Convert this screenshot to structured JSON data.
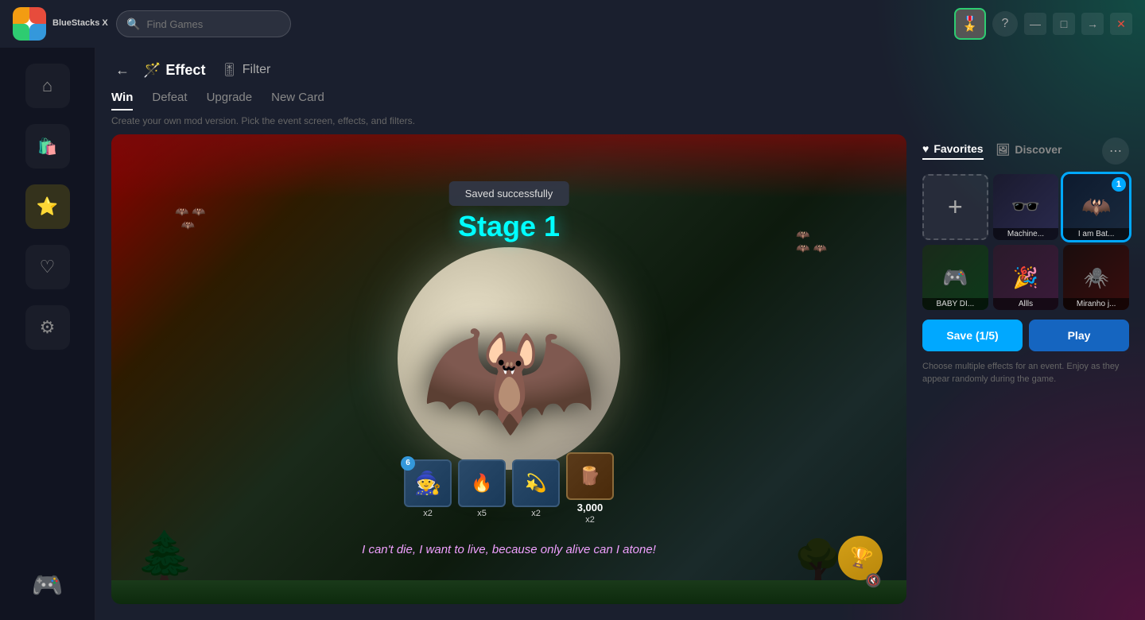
{
  "app": {
    "name": "BlueStacks X",
    "logo_icon": "🎮"
  },
  "titlebar": {
    "search_placeholder": "Find Games",
    "avatar_emoji": "🎖️",
    "help_btn": "?",
    "minimize_btn": "—",
    "restore_btn": "□",
    "forward_btn": "→",
    "close_btn": "✕"
  },
  "sidebar": {
    "items": [
      {
        "id": "home",
        "icon": "⌂",
        "label": "Home"
      },
      {
        "id": "store",
        "icon": "🛍️",
        "label": "Store"
      },
      {
        "id": "effects",
        "icon": "⭐",
        "label": "Effects",
        "active": true
      },
      {
        "id": "favorites",
        "icon": "♡",
        "label": "Favorites"
      },
      {
        "id": "settings",
        "icon": "⚙",
        "label": "Settings"
      }
    ],
    "logo": "🎮"
  },
  "header": {
    "back_label": "←",
    "section_icon": "🪄",
    "section_title": "Effect",
    "filter_icon": "🎚",
    "filter_label": "Filter"
  },
  "tabs": [
    {
      "id": "win",
      "label": "Win",
      "active": true
    },
    {
      "id": "defeat",
      "label": "Defeat"
    },
    {
      "id": "upgrade",
      "label": "Upgrade"
    },
    {
      "id": "new-card",
      "label": "New Card"
    }
  ],
  "subtitle": "Create your own mod version. Pick the event screen, effects, and filters.",
  "preview": {
    "toast": "Saved successfully",
    "stage_text": "Stage 1",
    "caption": "I can't die, I want to live, because only alive can I atone!",
    "card1_badge": "6",
    "card1_count": "x2",
    "card2_count": "x5",
    "card3_count": "x2",
    "card4_value": "3,000",
    "card4_count": "x2"
  },
  "panel": {
    "share_icon": "⋯",
    "tabs": [
      {
        "id": "favorites",
        "label": "Favorites",
        "icon": "♥",
        "active": true
      },
      {
        "id": "discover",
        "label": "Discover",
        "icon": "🖼"
      }
    ],
    "thumbnails": [
      {
        "id": "add-new",
        "type": "add",
        "icon": "+",
        "label": ""
      },
      {
        "id": "machine",
        "type": "machine",
        "emoji": "🕶️",
        "label": "Machine...",
        "badge": null
      },
      {
        "id": "batman",
        "type": "batman",
        "emoji": "🦇",
        "label": "I am Bat...",
        "badge": "1",
        "selected": true
      },
      {
        "id": "baby-di",
        "type": "baby",
        "emoji": "🎮",
        "label": "BABY DI...",
        "badge": null
      },
      {
        "id": "allls",
        "type": "allls",
        "emoji": "🎉",
        "label": "Allls",
        "badge": null
      },
      {
        "id": "miranho",
        "type": "miranho",
        "emoji": "🕷️",
        "label": "Miranho j...",
        "badge": null
      }
    ],
    "save_label": "Save (1/5)",
    "play_label": "Play",
    "help_text": "Choose multiple effects for an event. Enjoy as they appear randomly during the game."
  }
}
